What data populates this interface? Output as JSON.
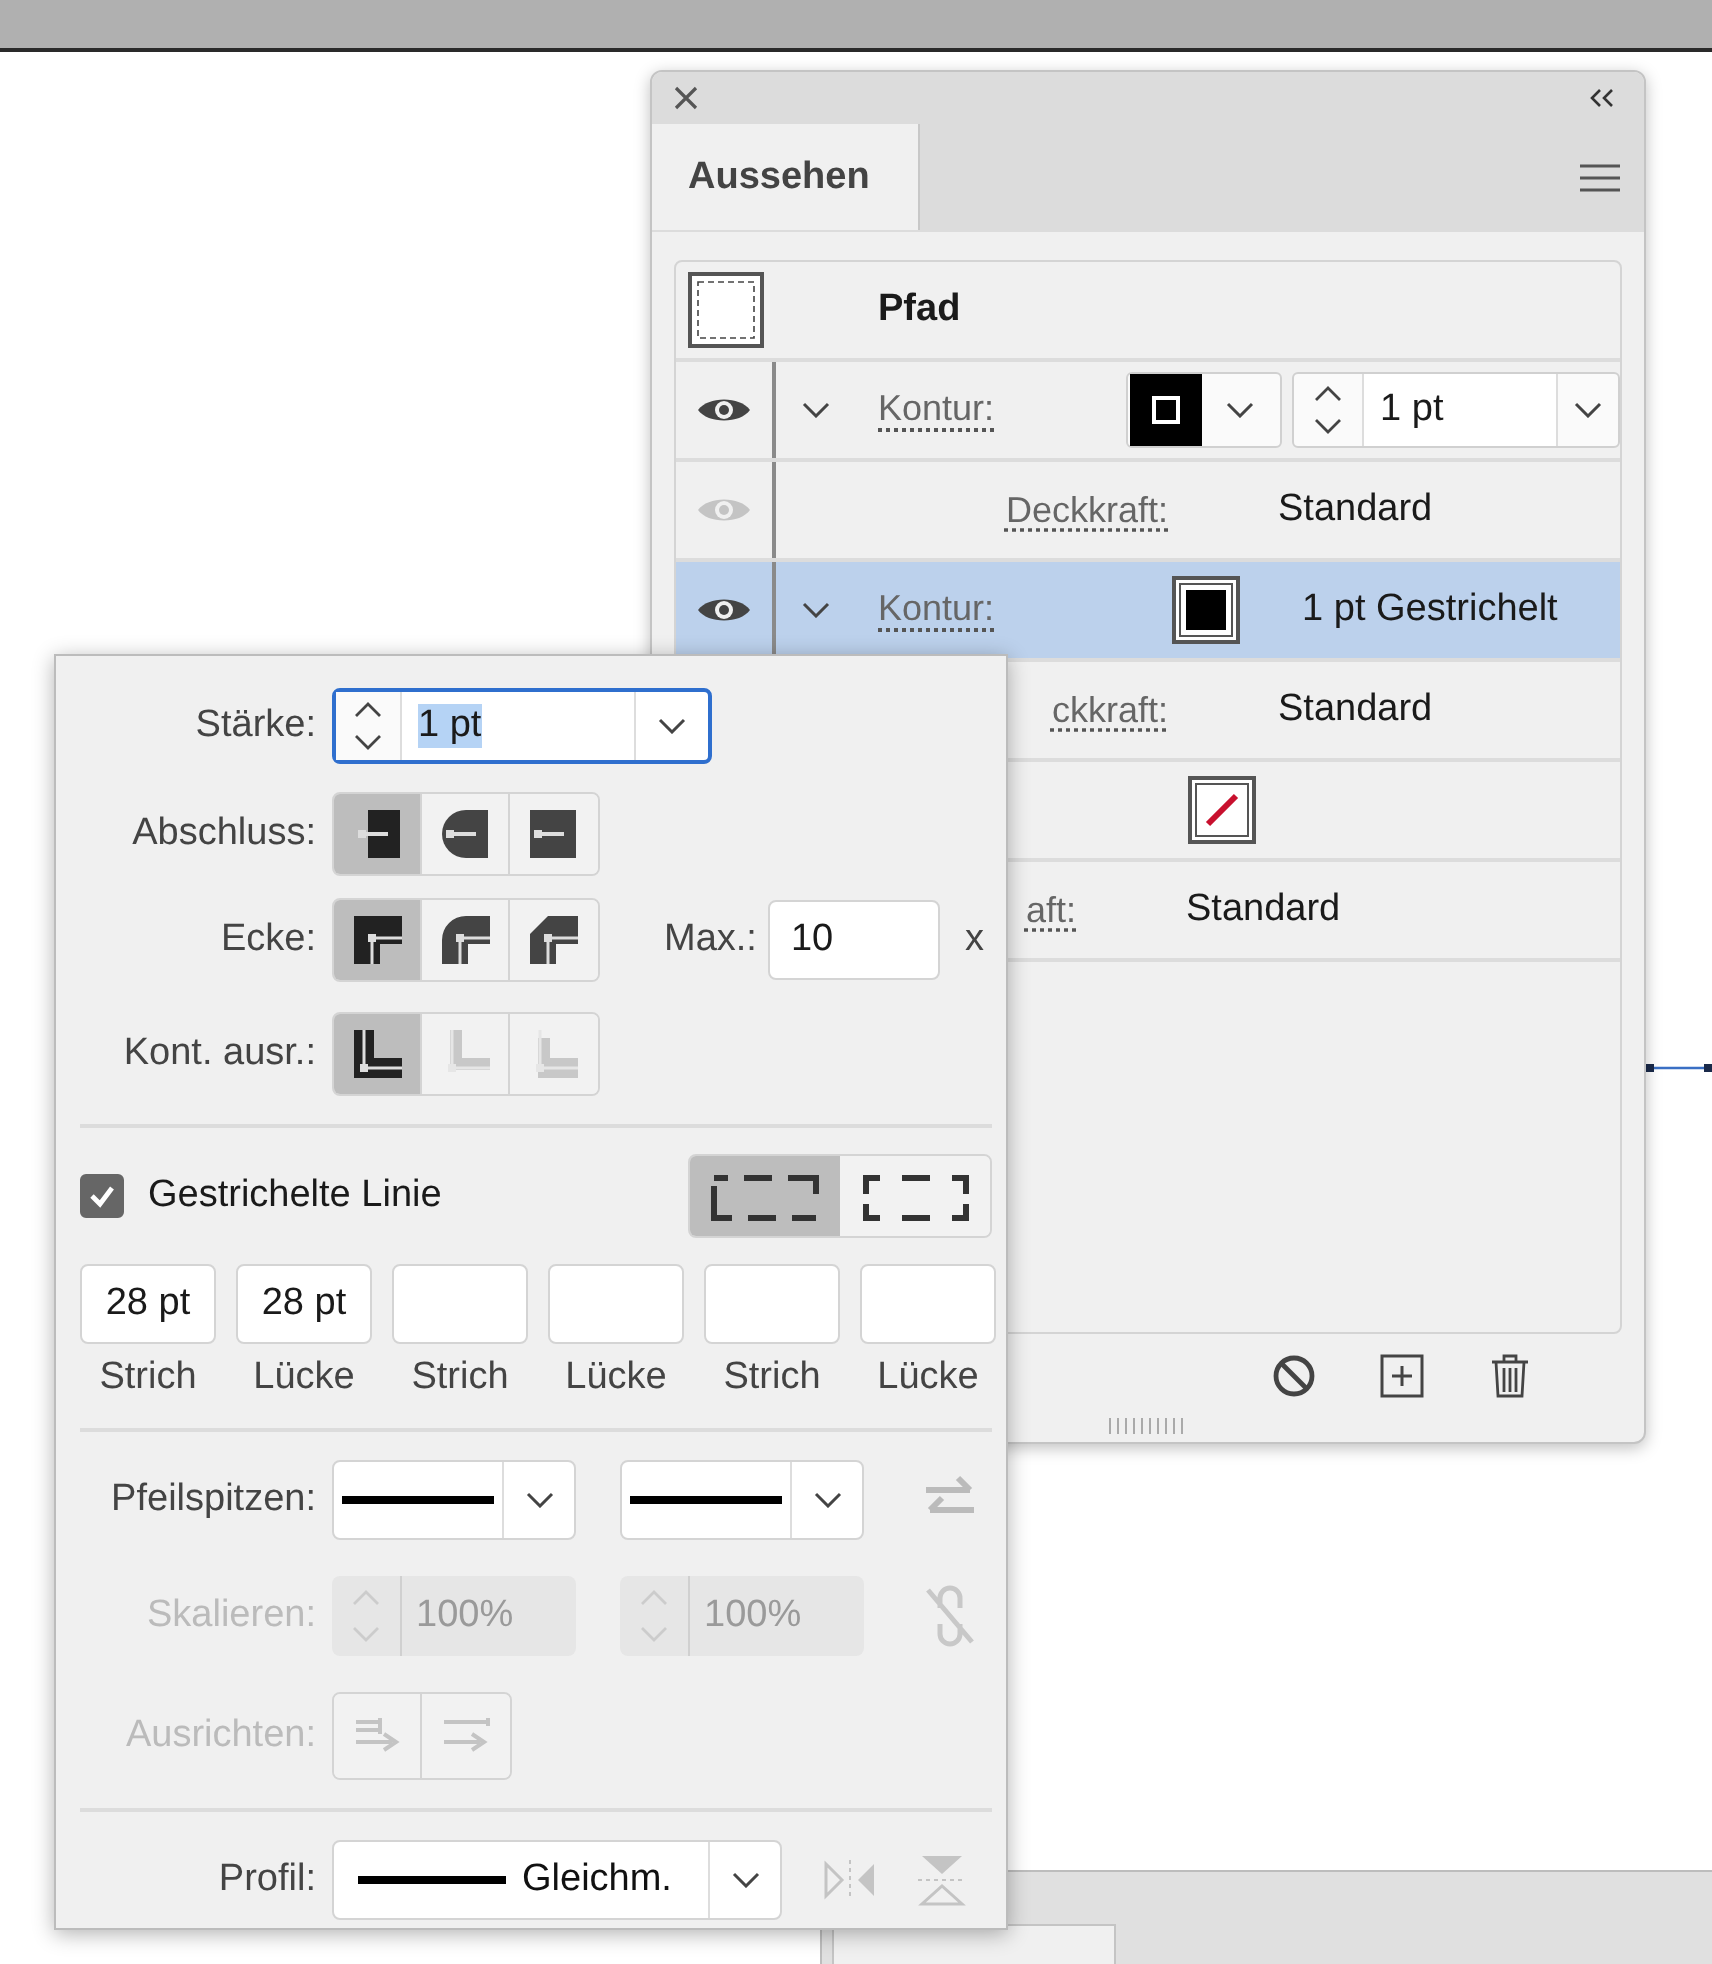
{
  "appearance_panel": {
    "tab": "Aussehen",
    "rows": [
      {
        "kind": "object",
        "title": "Pfad",
        "selected": false
      },
      {
        "kind": "stroke_edit",
        "visible": true,
        "label": "Kontur:",
        "weight": "1 pt",
        "selected": false
      },
      {
        "kind": "opacity",
        "visible": false,
        "label": "Deckkraft:",
        "value": "Standard",
        "selected": false
      },
      {
        "kind": "stroke",
        "visible": true,
        "label": "Kontur:",
        "value": "1 pt Gestrichelt",
        "selected": true
      },
      {
        "kind": "opacity",
        "label": "ckkraft:",
        "value": "Standard",
        "selected": false
      },
      {
        "kind": "fill",
        "selected": false
      },
      {
        "kind": "fill_opacity",
        "label": "aft:",
        "value": "Standard",
        "selected": false
      }
    ]
  },
  "stroke_panel": {
    "weight": {
      "label": "Stärke:",
      "value": "1 pt"
    },
    "cap": {
      "label": "Abschluss:",
      "options": [
        {
          "kind": "butt",
          "selected": true
        },
        {
          "kind": "round",
          "selected": false
        },
        {
          "kind": "projecting",
          "selected": false
        }
      ]
    },
    "corner": {
      "label": "Ecke:",
      "options": [
        {
          "kind": "miter",
          "selected": true
        },
        {
          "kind": "round",
          "selected": false
        },
        {
          "kind": "bevel",
          "selected": false
        }
      ],
      "limit_label": "Max.:",
      "limit": "10",
      "limit_unit": "x"
    },
    "align": {
      "label": "Kont. ausr.:",
      "options": [
        {
          "kind": "center",
          "selected": true,
          "disabled": false
        },
        {
          "kind": "inside",
          "selected": false,
          "disabled": true
        },
        {
          "kind": "outside",
          "selected": false,
          "disabled": true
        }
      ]
    },
    "dashed": {
      "label": "Gestrichelte Linie",
      "checked": true,
      "styles": [
        {
          "kind": "exact",
          "selected": true
        },
        {
          "kind": "adjust",
          "selected": false
        }
      ],
      "fields": [
        {
          "value": "28 pt",
          "label": "Strich"
        },
        {
          "value": "28 pt",
          "label": "Lücke"
        },
        {
          "label": "Strich"
        },
        {
          "label": "Lücke"
        },
        {
          "label": "Strich"
        },
        {
          "label": "Lücke"
        }
      ]
    },
    "arrowheads": {
      "label": "Pfeilspitzen:"
    },
    "scale": {
      "label": "Skalieren:",
      "disabled": true,
      "values": [
        "100%",
        "100%"
      ]
    },
    "arrow_align": {
      "label": "Ausrichten:",
      "disabled": true
    },
    "profile": {
      "label": "Profil:",
      "value": "Gleichm."
    }
  }
}
